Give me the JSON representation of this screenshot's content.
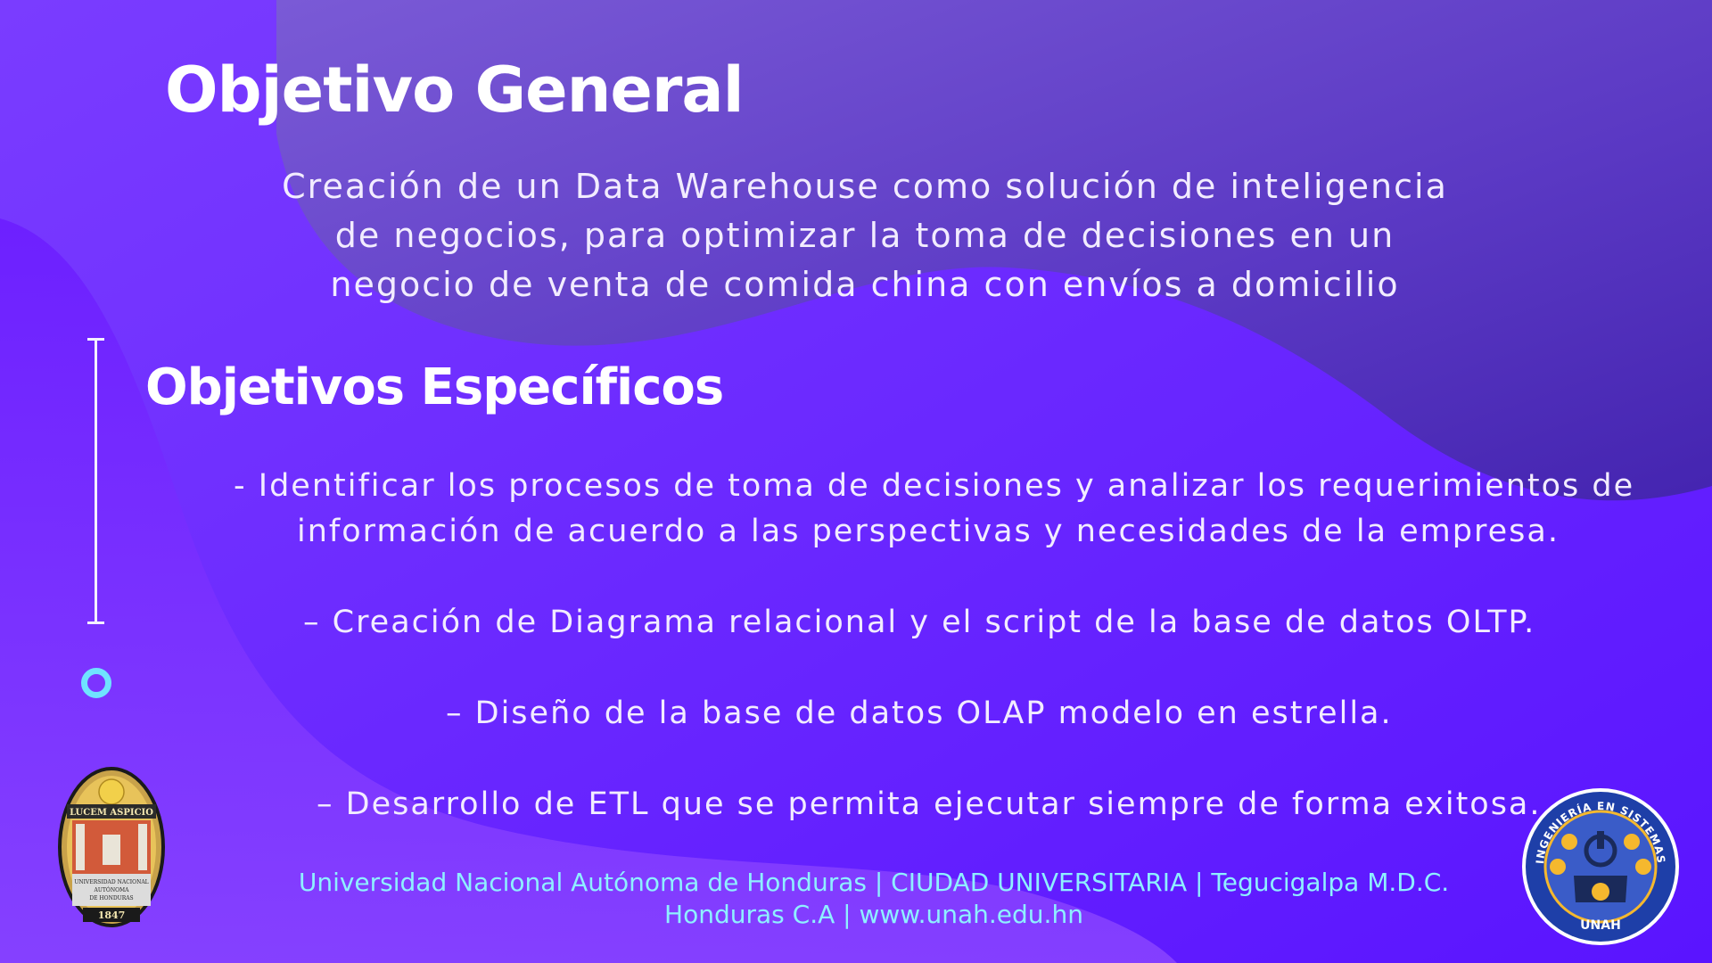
{
  "general": {
    "title": "Objetivo General",
    "lines": [
      "Creación de un Data Warehouse como solución de inteligencia",
      "de negocios, para optimizar la toma de decisiones en un",
      "negocio de venta de comida china con envíos a domicilio"
    ]
  },
  "specific": {
    "title": "Objetivos Específicos",
    "items": [
      "- Identificar los procesos de toma de decisiones y analizar los requerimientos de",
      "información de acuerdo a las perspectivas y necesidades de la empresa.",
      "– Creación de Diagrama relacional y el script de la base de datos OLTP.",
      "– Diseño de la base de datos OLAP modelo en estrella.",
      "– Desarrollo de ETL que se permita ejecutar siempre de forma exitosa."
    ]
  },
  "footer": {
    "line1": "Universidad Nacional Autónoma de Honduras | CIUDAD UNIVERSITARIA  | Tegucigalpa M.D.C.",
    "line2": "Honduras C.A | www.unah.edu.hn"
  },
  "seal": {
    "motto": "LUCEM ASPICIO",
    "name_line1": "UNIVERSIDAD NACIONAL",
    "name_line2": "AUTÓNOMA",
    "name_line3": "DE HONDURAS",
    "year": "1847"
  },
  "badge": {
    "ring_text": "INGENIERÍA EN SISTEMAS",
    "bottom_text": "UNAH"
  },
  "colors": {
    "accent_cyan": "#6fe3ff",
    "footer_text": "#8ef0ff",
    "background_purple": "#6a1fff"
  }
}
